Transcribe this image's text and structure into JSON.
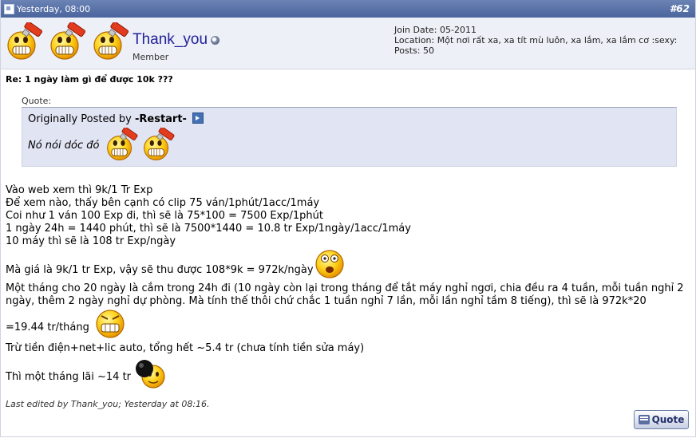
{
  "header": {
    "date": "Yesterday, 08:00",
    "post_number": "#62"
  },
  "user": {
    "name": "Thank_you",
    "title": "Member",
    "join_date": "Join Date: 05-2011",
    "location": "Location: Một nơi rất xa, xa tít mù luôn, xa lắm, xa lắm cơ :sexy:",
    "posts": "Posts: 50",
    "avatar_icons": [
      "smiley-paint-icon",
      "smiley-paint-icon",
      "smiley-paint-icon"
    ]
  },
  "post": {
    "title": "Re: 1 ngày làm gì để được 10k ???",
    "quote": {
      "label": "Quote:",
      "originally_posted_by": "Originally Posted by",
      "author": "-Restart-",
      "text": "Nó nói dóc đó",
      "smilies": [
        "smiley-paint-icon",
        "smiley-paint-icon"
      ]
    },
    "lines": [
      "Vào web xem thì 9k/1 Tr Exp",
      "Để xem nào, thấy bên cạnh có clip 75 ván/1phút/1acc/1máy",
      "Coi như 1 ván 100 Exp đi, thì sẽ là 75*100 = 7500 Exp/1phút",
      "1 ngày 24h = 1440 phút, thì sẽ là 7500*1440 = 10.8 tr Exp/1ngày/1acc/1máy",
      "10 máy thì sẽ là 108 tr Exp/ngày",
      "Mà giá là 9k/1 tr Exp, vậy sẽ thu được 108*9k = 972k/ngày",
      "Một tháng cho 20 ngày là cắm trong 24h đi (10 ngày còn lại trong tháng để tắt máy nghỉ ngơi, chia đều ra 4 tuần, mỗi tuần nghỉ 2 ngày, thêm 2 ngày nghỉ dự phòng. Mà tính thế thôi chứ chắc 1 tuần nghỉ 7 lần, mỗi lần nghỉ tầm 8 tiếng), thì sẽ là 972k*20",
      "=19.44 tr/tháng",
      "Trừ tiền điện+net+lic auto, tổng hết ~5.4 tr (chưa tính tiền sửa máy)",
      "Thì một tháng lãi ~14 tr"
    ],
    "inline_smilies": [
      "shocked-smiley-icon",
      "scared-smiley-icon",
      "bomb-smiley-icon"
    ],
    "last_edited": "Last edited by Thank_you; Yesterday at 08:16."
  },
  "actions": {
    "quote_label": "Quote"
  }
}
